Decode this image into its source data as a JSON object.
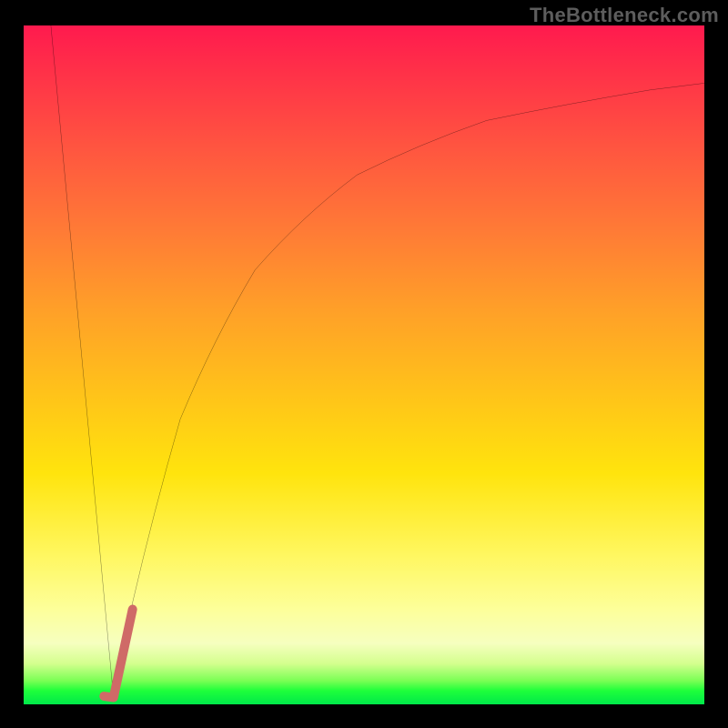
{
  "watermark": "TheBottleneck.com",
  "chart_data": {
    "type": "line",
    "title": "",
    "xlabel": "",
    "ylabel": "",
    "xlim": [
      0,
      100
    ],
    "ylim": [
      0,
      100
    ],
    "grid": false,
    "legend": false,
    "description": "Bottleneck-style curve: black V-shaped line starting at upper-left, dipping to a minimum near x≈13 at the green band (y≈0), then rising with diminishing slope toward upper-right. A short salmon-colored thick tick segment marks the minimum. Background is a vertical red→yellow→green heat gradient.",
    "series": [
      {
        "name": "black-curve-left",
        "stroke": "#000000",
        "strokeWidth": 2,
        "x": [
          4,
          13.2
        ],
        "y": [
          100,
          1
        ]
      },
      {
        "name": "black-curve-right",
        "stroke": "#000000",
        "strokeWidth": 2,
        "x": [
          13.2,
          16,
          19,
          23,
          28,
          34,
          41,
          49,
          58,
          68,
          80,
          92,
          100
        ],
        "y": [
          1,
          15,
          28,
          42,
          54,
          64,
          72,
          78,
          82.5,
          86,
          88.5,
          90.5,
          91.5
        ]
      },
      {
        "name": "highlight-tick",
        "stroke": "#cf6a67",
        "strokeWidth": 10,
        "linecap": "round",
        "x": [
          11.8,
          13.2,
          16.0
        ],
        "y": [
          1.2,
          1.0,
          14.0
        ]
      }
    ],
    "gradient_stops": [
      {
        "pos": 0,
        "color": "#ff1a4e"
      },
      {
        "pos": 50,
        "color": "#ffc21a"
      },
      {
        "pos": 90,
        "color": "#fdff9a"
      },
      {
        "pos": 100,
        "color": "#00e84a"
      }
    ]
  }
}
